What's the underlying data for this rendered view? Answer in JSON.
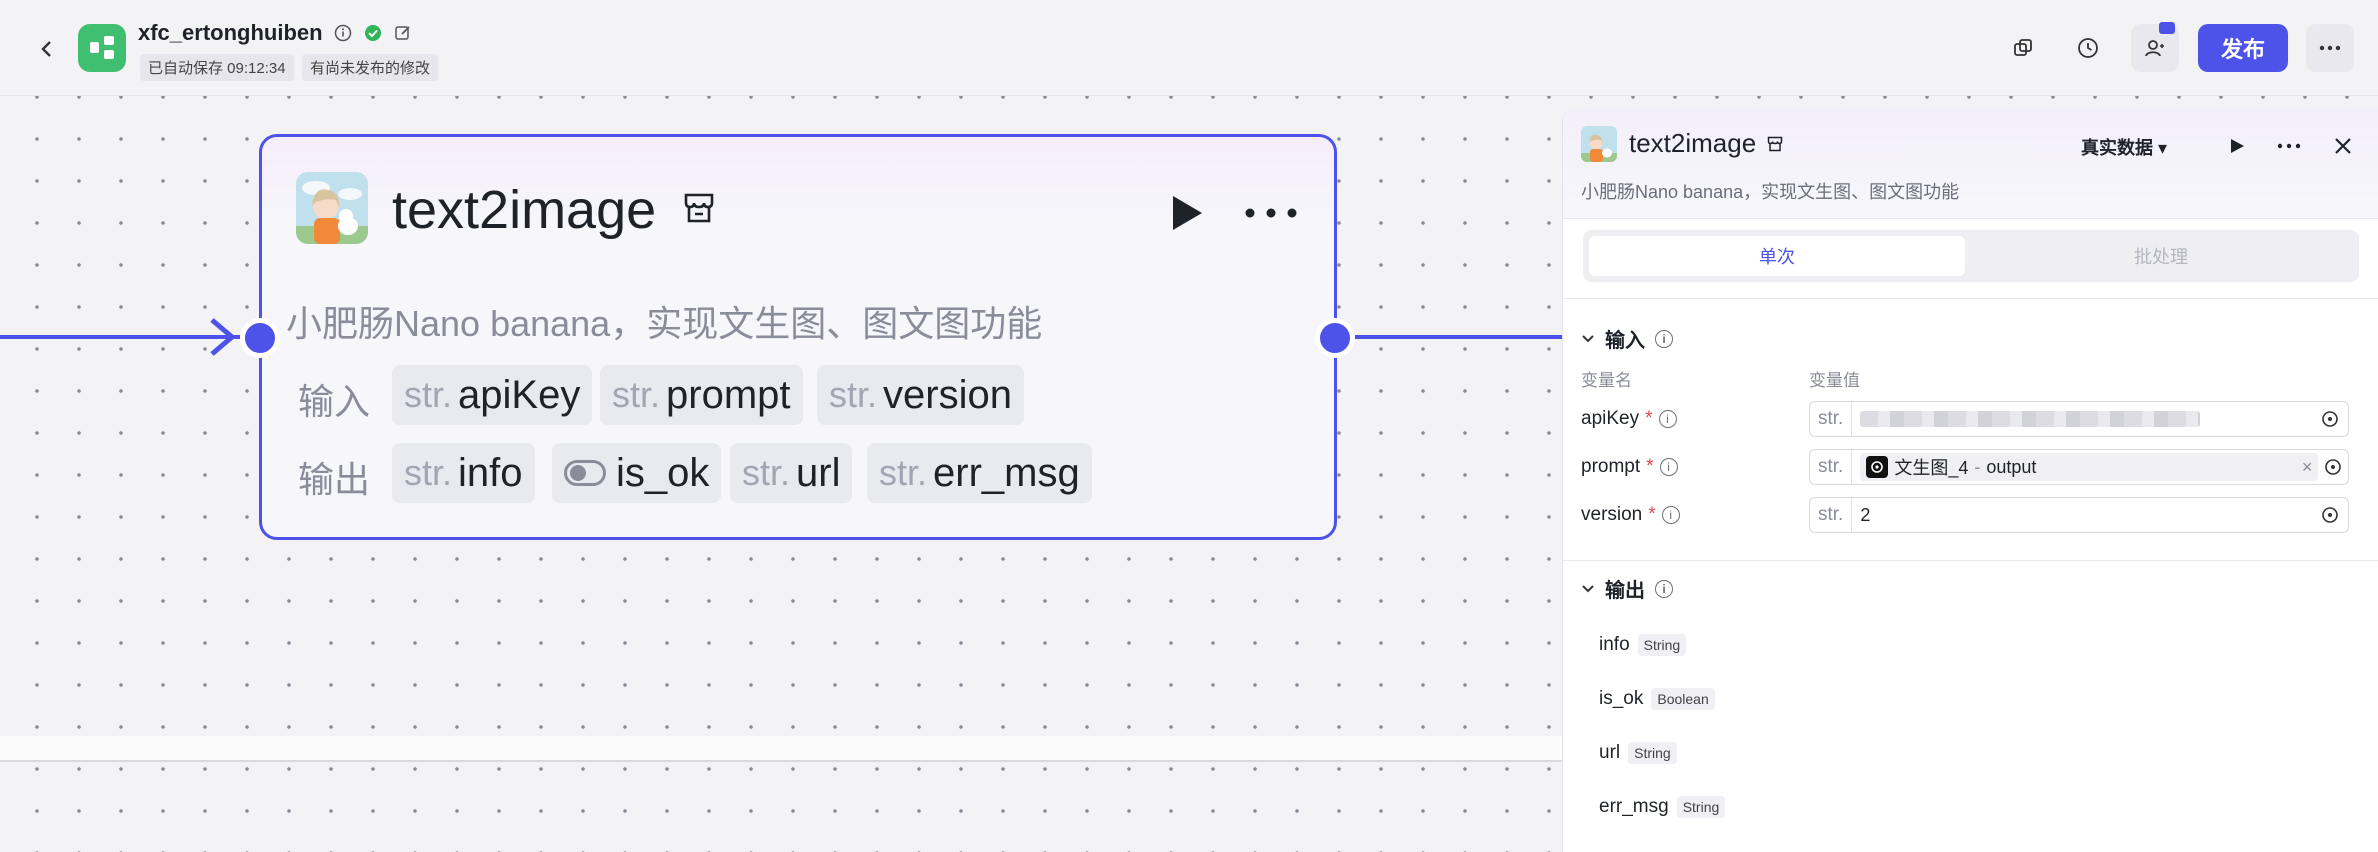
{
  "header": {
    "app_name": "xfc_ertonghuiben",
    "autosave": "已自动保存 09:12:34",
    "unpublished": "有尚未发布的修改",
    "publish_label": "发布"
  },
  "node": {
    "title": "text2image",
    "description": "小肥肠Nano banana，实现文生图、图文图功能",
    "input_label": "输入",
    "output_label": "输出",
    "inputs": [
      {
        "type": "str.",
        "name": "apiKey"
      },
      {
        "type": "str.",
        "name": "prompt"
      },
      {
        "type": "str.",
        "name": "version"
      }
    ],
    "outputs": [
      {
        "type": "str.",
        "name": "info"
      },
      {
        "type": "",
        "name": "is_ok"
      },
      {
        "type": "str.",
        "name": "url"
      },
      {
        "type": "str.",
        "name": "err_msg"
      }
    ]
  },
  "panel": {
    "title": "text2image",
    "description": "小肥肠Nano banana，实现文生图、图文图功能",
    "data_mode": "真实数据",
    "tabs": [
      "单次",
      "批处理"
    ],
    "input_section": "输入",
    "col_name": "变量名",
    "col_value": "变量值",
    "params": [
      {
        "name": "apiKey",
        "required": "*",
        "type": "str.",
        "value": ""
      },
      {
        "name": "prompt",
        "required": "*",
        "type": "str.",
        "ref_node": "文生图_4",
        "ref_sep": "-",
        "ref_field": "output",
        "clear": "×"
      },
      {
        "name": "version",
        "required": "*",
        "type": "str.",
        "value": "2"
      }
    ],
    "output_section": "输出",
    "outputs": [
      {
        "name": "info",
        "type": "String"
      },
      {
        "name": "is_ok",
        "type": "Boolean"
      },
      {
        "name": "url",
        "type": "String"
      },
      {
        "name": "err_msg",
        "type": "String"
      }
    ]
  },
  "colors": {
    "accent": "#4d53e8",
    "app_green": "#3fbf6f",
    "ok_green": "#2fb45a"
  }
}
